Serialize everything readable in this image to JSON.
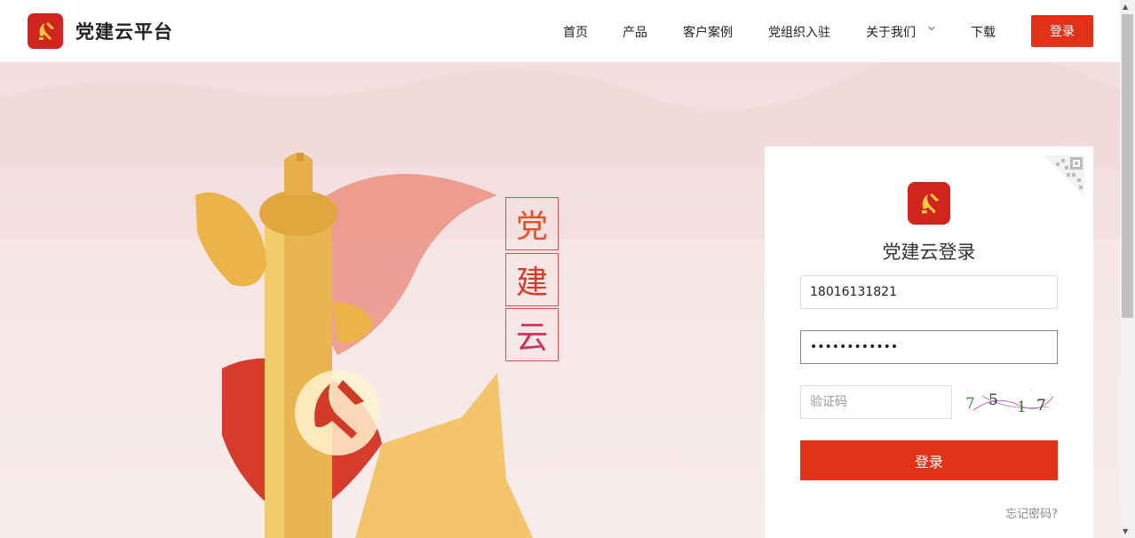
{
  "brand": {
    "name": "党建云平台",
    "logo_icon": "party-emblem-icon",
    "logo_color": "#d0241c"
  },
  "nav": {
    "items": [
      "首页",
      "产品",
      "客户案例",
      "党组织入驻",
      "关于我们",
      "下载"
    ],
    "about_dropdown_icon": "chevron-down-icon",
    "login_label": "登录",
    "accent": "#e23318"
  },
  "hero": {
    "vertical_chars": [
      "党",
      "建",
      "云"
    ]
  },
  "login": {
    "title": "党建云登录",
    "qr_icon": "qr-code-icon",
    "username": "18016131821",
    "password": "••••••••••••",
    "captcha_placeholder": "验证码",
    "captcha_digits": [
      "7",
      "5",
      "1",
      "7"
    ],
    "submit_label": "登录",
    "forgot_label": "忘记密码?"
  }
}
